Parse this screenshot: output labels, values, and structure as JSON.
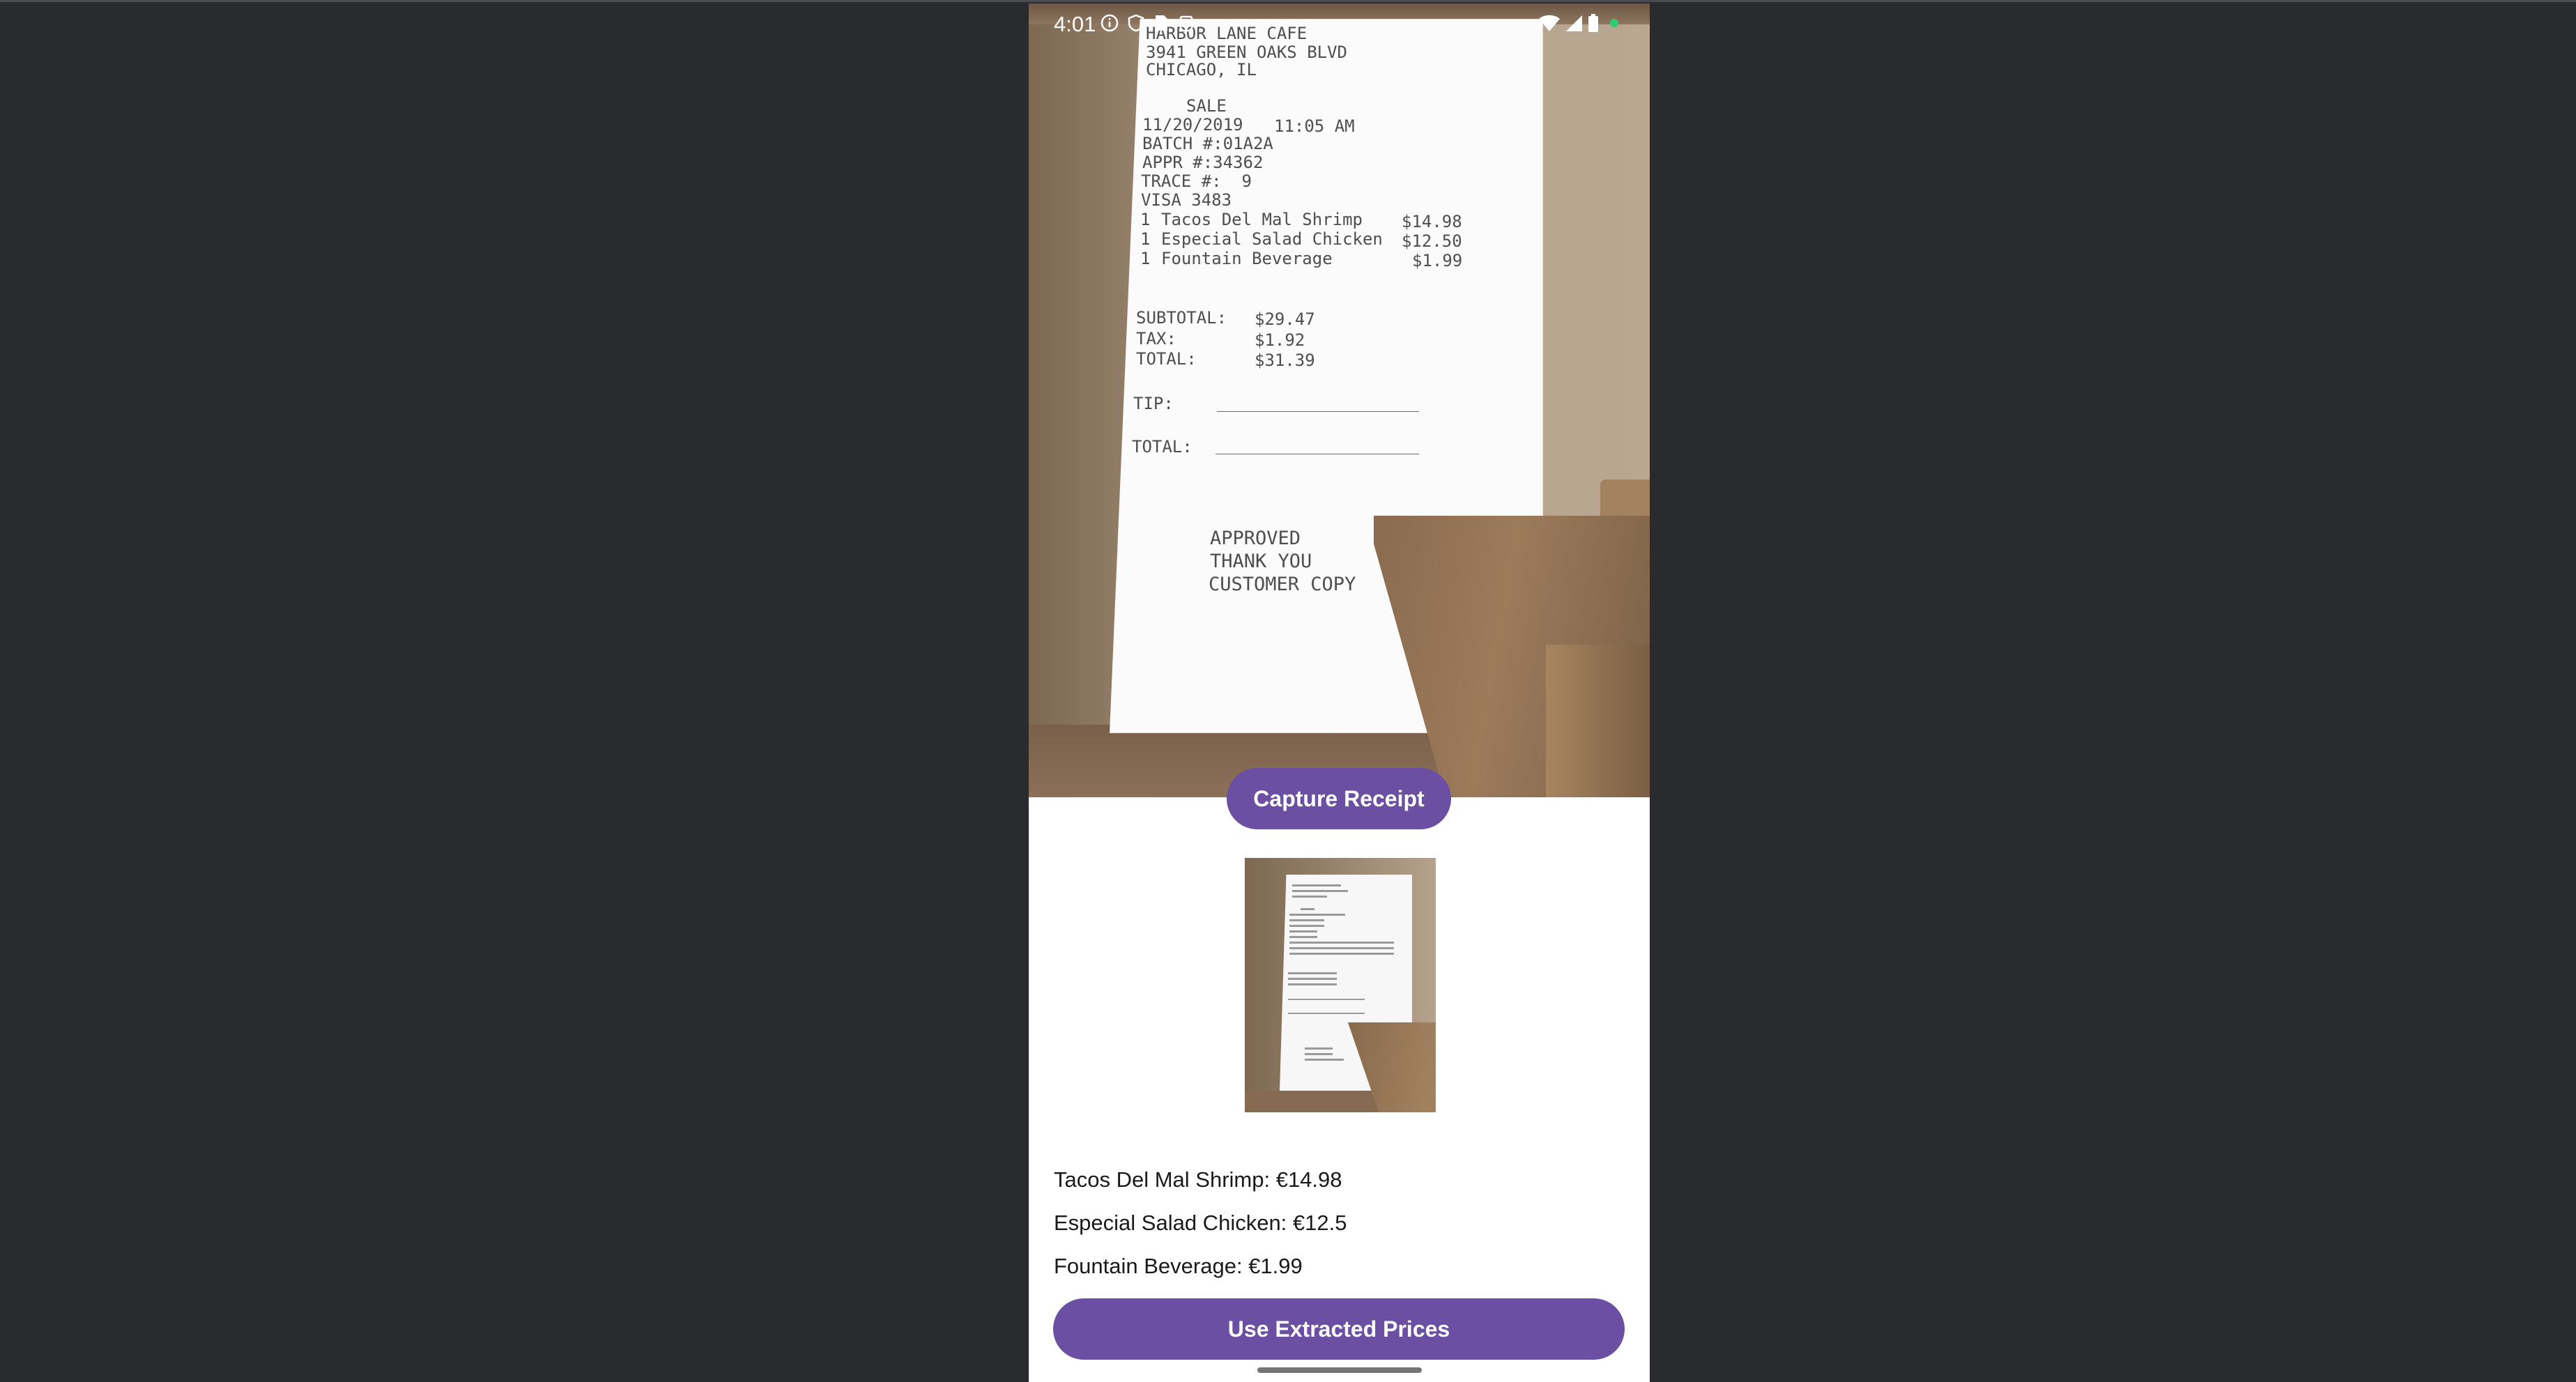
{
  "status_bar": {
    "time": "4:01",
    "icons": [
      "info-icon",
      "shield-icon",
      "sim-icon",
      "clipboard-icon",
      "wifi-icon",
      "signal-icon",
      "battery-icon",
      "camera-active-dot"
    ]
  },
  "receipt": {
    "header": [
      "HARBOR LANE CAFE",
      "3941 GREEN OAKS BLVD",
      "CHICAGO, IL"
    ],
    "sale_label": "SALE",
    "date": "11/20/2019",
    "time": "11:05 AM",
    "batch": "BATCH #:01A2A",
    "appr": "APPR #:34362",
    "trace": "TRACE #:  9",
    "card": "VISA 3483",
    "lines": [
      {
        "qty": "1",
        "name": "Tacos Del Mal Shrimp",
        "price": "$14.98"
      },
      {
        "qty": "1",
        "name": "Especial Salad Chicken",
        "price": "$12.50"
      },
      {
        "qty": "1",
        "name": "Fountain Beverage",
        "price": "$1.99"
      }
    ],
    "subtotal_label": "SUBTOTAL:",
    "subtotal": "$29.47",
    "tax_label": "TAX:",
    "tax": "$1.92",
    "total_label": "TOTAL:",
    "total": "$31.39",
    "tip_label": "TIP:",
    "total2_label": "TOTAL:",
    "footer": [
      "APPROVED",
      "THANK YOU",
      "CUSTOMER COPY"
    ]
  },
  "buttons": {
    "capture": "Capture Receipt",
    "use_prices": "Use Extracted Prices"
  },
  "extracted_items": [
    "Tacos Del Mal Shrimp: €14.98",
    "Especial Salad Chicken: €12.5",
    "Fountain Beverage: €1.99"
  ],
  "colors": {
    "accent": "#6a4fa3",
    "background": "#2a2b2f"
  }
}
